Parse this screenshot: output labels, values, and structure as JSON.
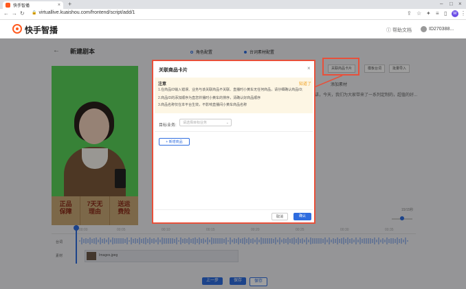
{
  "browser": {
    "tab_title": "快手智播",
    "url": "virtuallive.kuaishou.com/frontend/script/add/1"
  },
  "header": {
    "logo": "快手智播",
    "help": "帮助文档",
    "user_id": "ID270388..."
  },
  "page": {
    "title": "新建剧本",
    "steps": [
      "角色配置",
      "台词素材配置"
    ],
    "video_badges": [
      "正品\n保障",
      "7天无\n理由",
      "送运\n费险"
    ],
    "toolbar": [
      "关联商品卡片",
      "模板台词",
      "批量导入"
    ],
    "ai_label": "添加素材",
    "script_preview": "讲，今天，我们为大家带来了一系列定制的，超值的好...",
    "ratio": "15/15秒",
    "timeline": {
      "ticks": [
        "00:00",
        "00:05",
        "00:10",
        "00:15",
        "00:20",
        "00:25",
        "00:30",
        "00:35",
        "00:40",
        "00:45"
      ],
      "track_voice": "台词",
      "track_material": "素材",
      "clip_name": "Images.jpeg"
    },
    "buttons": {
      "prev": "上一步",
      "save": "保存",
      "save2": "保存"
    }
  },
  "modal": {
    "title": "关联商品卡片",
    "notice_title": "注意",
    "notice_link": "知道了",
    "notice_lines": [
      "1.在商品ID输入错误、业务与该关联商品不关联、直播时小黄车无任何商品，请仔细确认商品ID;",
      "2.商品ID的添加顺序为直您并播时小黄车的排序，清确认好商品顺序",
      "3.商品名称仅在本平台生效，不影响直播间小黄车商品名称"
    ],
    "biz_label": "目标业务:",
    "biz_placeholder": "请选择目标业务",
    "add_button": "新增商品",
    "cancel": "取消",
    "confirm": "确认"
  }
}
